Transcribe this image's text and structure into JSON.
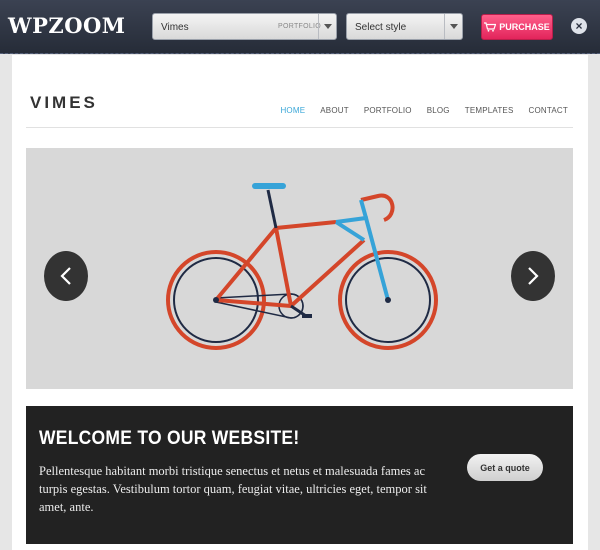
{
  "demobar": {
    "logo": "WPZOOM",
    "theme_select": {
      "value": "Vimes",
      "tag": "PORTFOLIO"
    },
    "style_select": {
      "value": "Select style"
    },
    "purchase_label": "PURCHASE",
    "close_label": "×"
  },
  "site": {
    "title": "VIMES",
    "nav": [
      "HOME",
      "ABOUT",
      "PORTFOLIO",
      "BLOG",
      "TEMPLATES",
      "CONTACT"
    ],
    "active_nav": "HOME"
  },
  "slider": {
    "prev_label": "‹",
    "next_label": "›",
    "image": "bicycle-illustration",
    "colors": {
      "frame": "#d4462a",
      "fork": "#36a3d8",
      "tire_outer": "#d4462a",
      "rim": "#1f2a44"
    }
  },
  "welcome": {
    "heading": "WELCOME TO OUR WEBSITE!",
    "body": "Pellentesque habitant morbi tristique senectus et netus et malesuada fames ac turpis egestas. Vestibulum tortor quam, feugiat vitae, ultricies eget, tempor sit amet, ante.",
    "button_label": "Get a quote"
  },
  "icons": {
    "cart": "cart-icon",
    "close": "close-icon",
    "prev": "chevron-left-icon",
    "next": "chevron-right-icon"
  }
}
